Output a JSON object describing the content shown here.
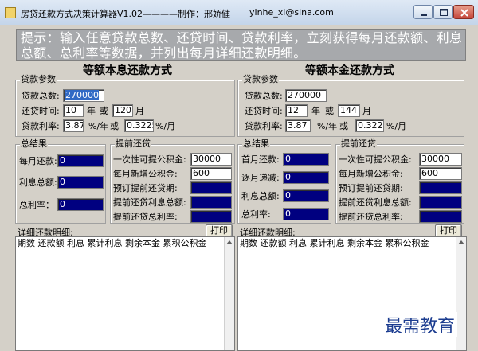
{
  "window": {
    "title": "房贷还款方式决策计算器V1.02————制作：邢娇健",
    "email": "yinhe_xi@sina.com"
  },
  "hint": {
    "line1": "提示：输入任意贷款总数、还贷时间、贷款利率，立刻获得每月还款额、利息",
    "line2": "总额、总利率等数据，并列出每月详细还款明细。"
  },
  "left": {
    "title": "等额本息还款方式",
    "params": {
      "legend": "贷款参数",
      "total_label": "贷款总数:",
      "total_value": "270000",
      "time_label": "还贷时间:",
      "years_value": "10",
      "year_unit": "年",
      "or": "或",
      "months_value": "120",
      "month_unit": "月",
      "rate_label": "贷款利率:",
      "rate_year": "3.87",
      "rate_year_unit": "%/年",
      "rate_month": "0.3225",
      "rate_month_unit": "%/月"
    },
    "result": {
      "legend": "总结果",
      "monthly_label": "每月还款:",
      "monthly_value": "0",
      "interest_label": "利息总额:",
      "interest_value": "0",
      "total_rate_label": "总利率：",
      "total_rate_value": "0"
    },
    "prepay": {
      "legend": "提前还贷",
      "once_label": "一次性可提公积金:",
      "once_value": "30000",
      "monthly_add_label": "每月新增公积金:",
      "monthly_add_value": "600",
      "period_label": "预订提前还贷期:",
      "interest_label": "提前还贷利息总额:",
      "rate_label": "提前还贷总利率:"
    },
    "detail_label": "详细还款明细:",
    "print_label": "打印",
    "columns": "期数 还款额  利息  累计利息 剩余本金 累积公积金"
  },
  "right": {
    "title": "等额本金还款方式",
    "params": {
      "legend": "贷款参数",
      "total_label": "贷款总数:",
      "total_value": "270000",
      "time_label": "还贷时间:",
      "years_value": "12",
      "year_unit": "年",
      "or": "或",
      "months_value": "144",
      "month_unit": "月",
      "rate_label": "贷款利率:",
      "rate_year": "3.87",
      "rate_year_unit": "%/年",
      "rate_month": "0.3225",
      "rate_month_unit": "%/月"
    },
    "result": {
      "legend": "总结果",
      "first_label": "首月还款:",
      "first_value": "0",
      "decrease_label": "逐月递减:",
      "decrease_value": "0",
      "interest_label": "利息总额:",
      "interest_value": "0",
      "total_rate_label": "总利率:",
      "total_rate_value": "0"
    },
    "prepay": {
      "legend": "提前还贷",
      "once_label": "一次性可提公积金:",
      "once_value": "30000",
      "monthly_add_label": "每月新增公积金:",
      "monthly_add_value": "600",
      "period_label": "预订提前还贷期:",
      "interest_label": "提前还贷利息总额:",
      "rate_label": "提前还贷总利率:"
    },
    "detail_label": "详细还款明细:",
    "print_label": "打印",
    "columns": "期数 还款额  利息  累计利息 剩余本金 累积公积金"
  },
  "watermark": "最需教育",
  "colors": {
    "output_bg": "#000080",
    "hint_bg": "#a7a9ac",
    "panel_bg": "#d4d0c8",
    "watermark": "#1a3b8f"
  },
  "icons": [
    "app-icon",
    "minimize-icon",
    "maximize-icon",
    "close-icon",
    "scroll-up-icon"
  ]
}
